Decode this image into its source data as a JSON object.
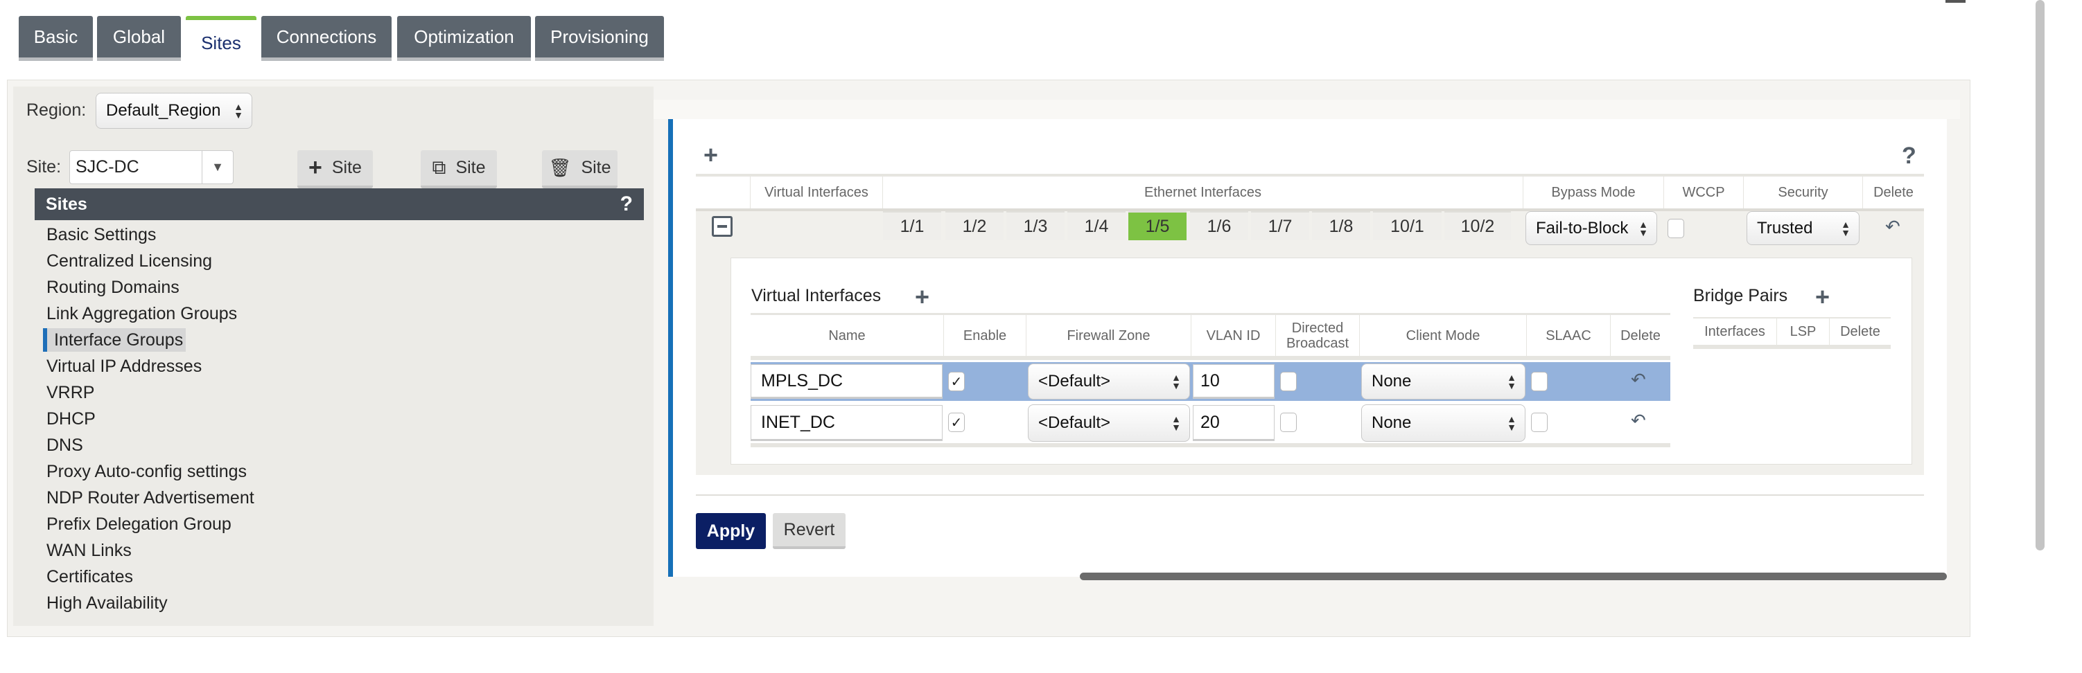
{
  "tabs": [
    {
      "label": "Basic"
    },
    {
      "label": "Global"
    },
    {
      "label": "Sites",
      "active": true
    },
    {
      "label": "Connections"
    },
    {
      "label": "Optimization"
    },
    {
      "label": "Provisioning"
    }
  ],
  "colors": {
    "accent_green": "#7dc243",
    "header_dark": "#474e57",
    "apply_navy": "#0b1f64",
    "row_highlight": "#94b2dc",
    "tab_gray": "#5c656e"
  },
  "left": {
    "region_label": "Region:",
    "region_value": "Default_Region",
    "site_label": "Site:",
    "site_value": "SJC-DC",
    "add_site": "Site",
    "copy_site": "Site",
    "delete_site": "Site",
    "sites_header": "Sites",
    "help": "?",
    "menu": [
      "Basic Settings",
      "Centralized Licensing",
      "Routing Domains",
      "Link Aggregation Groups",
      "Interface Groups",
      "Virtual IP Addresses",
      "VRRP",
      "DHCP",
      "DNS",
      "Proxy Auto-config settings",
      "NDP Router Advertisement",
      "Prefix Delegation Group",
      "WAN Links",
      "Certificates",
      "High Availability"
    ],
    "selected": "Interface Groups"
  },
  "main": {
    "help": "?",
    "headers": [
      "Virtual Interfaces",
      "Ethernet Interfaces",
      "Bypass Mode",
      "WCCP",
      "Security",
      "Delete"
    ],
    "ethernet": [
      "1/1",
      "1/2",
      "1/3",
      "1/4",
      "1/5",
      "1/6",
      "1/7",
      "1/8",
      "10/1",
      "10/2"
    ],
    "ethernet_selected": "1/5",
    "bypass_mode": "Fail-to-Block",
    "wccp_checked": false,
    "security": "Trusted",
    "vi_title": "Virtual Interfaces",
    "vi_headers": [
      "Name",
      "Enable",
      "Firewall Zone",
      "VLAN ID",
      "Directed Broadcast",
      "Client Mode",
      "SLAAC",
      "Delete"
    ],
    "vi_rows": [
      {
        "name": "MPLS_DC",
        "enable": "✓",
        "zone": "<Default>",
        "vlan": "10",
        "directed_broadcast": false,
        "client_mode": "None",
        "slaac": false
      },
      {
        "name": "INET_DC",
        "enable": "✓",
        "zone": "<Default>",
        "vlan": "20",
        "directed_broadcast": false,
        "client_mode": "None",
        "slaac": false
      }
    ],
    "bp_title": "Bridge Pairs",
    "bp_headers": [
      "Interfaces",
      "LSP",
      "Delete"
    ],
    "apply": "Apply",
    "revert": "Revert"
  }
}
